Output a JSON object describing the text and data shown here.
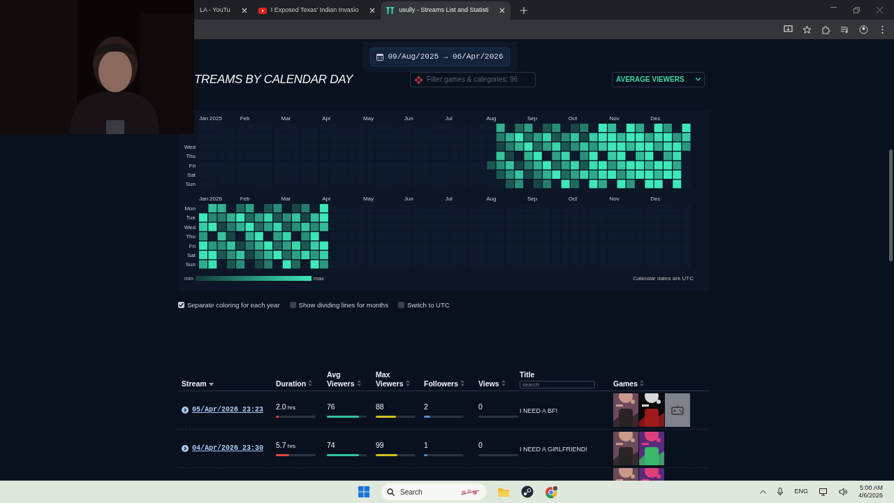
{
  "browser": {
    "tabs": [
      {
        "title": "LA - YouTu",
        "selected": false
      },
      {
        "title": "I Exposed Texas' Indian Invasio",
        "selected": false
      },
      {
        "title": "usully - Streams List and Statisti",
        "selected": true
      }
    ]
  },
  "webcam": {
    "kind": "picture"
  },
  "date_range": {
    "from": "09/Aug/2025",
    "arrow": "→",
    "to": "06/Apr/2026"
  },
  "heading": "TREAMS BY CALENDAR DAY",
  "filter": {
    "placeholder": "Filter games & categories: 96"
  },
  "metric_select": {
    "value": "AVERAGE VIEWERS"
  },
  "calendar": {
    "years": [
      {
        "months": [
          "Jan 2025",
          "Feb",
          "Mar",
          "Apr",
          "May",
          "Jun",
          "Jul",
          "Aug",
          "Sep",
          "Oct",
          "Nov",
          "Dec"
        ],
        "day_labels": [
          "Wed",
          "Thu",
          "Fri",
          "Sat",
          "Sun"
        ]
      },
      {
        "months": [
          "Jan 2026",
          "Feb",
          "Mar",
          "Apr",
          "May",
          "Jun",
          "Jul",
          "Aug",
          "Sep",
          "Oct",
          "Nov",
          "Dec"
        ],
        "day_labels": [
          "Mon",
          "Tue",
          "Wed",
          "Thu",
          "Fri",
          "Sat",
          "Sun"
        ]
      }
    ],
    "legend_min": "min",
    "legend_max": "max",
    "note": "Calendar dates are UTC"
  },
  "options": [
    {
      "label": "Separate coloring for each year",
      "checked": true
    },
    {
      "label": "Show dividing lines for months",
      "checked": false
    },
    {
      "label": "Switch to UTC",
      "checked": false
    }
  ],
  "table": {
    "columns": [
      {
        "label": "Stream",
        "sorted": true
      },
      {
        "label": "Duration",
        "sorted": false
      },
      {
        "label": "Avg Viewers",
        "sorted": false
      },
      {
        "label": "Max Viewers",
        "sorted": false
      },
      {
        "label": "Followers",
        "sorted": false
      },
      {
        "label": "Views",
        "sorted": false
      },
      {
        "label": "Title",
        "search_placeholder": "search"
      },
      {
        "label": "Games",
        "sorted": false
      }
    ],
    "rows": [
      {
        "stream": "05/Apr/2026 23:23",
        "duration": {
          "value": "2.0",
          "unit": "hrs",
          "level": 0.07
        },
        "avg": {
          "value": "76",
          "level": 0.8
        },
        "max": {
          "value": "88",
          "level": 0.5
        },
        "followers": {
          "value": "2",
          "level": 0.15
        },
        "views": {
          "value": "0"
        },
        "title": "I NEED A BF!",
        "games": [
          {
            "kind": "picture"
          },
          {
            "kind": "picture"
          },
          {
            "kind": "placeholder"
          }
        ]
      },
      {
        "stream": "04/Apr/2026 23:30",
        "duration": {
          "value": "5.7",
          "unit": "hrs",
          "level": 0.33
        },
        "avg": {
          "value": "74",
          "level": 0.8
        },
        "max": {
          "value": "99",
          "level": 0.55
        },
        "followers": {
          "value": "1",
          "level": 0.08
        },
        "views": {
          "value": "0"
        },
        "title": "I NEED A GIRLFRIEND!",
        "games": [
          {
            "kind": "picture"
          },
          {
            "kind": "picture"
          }
        ]
      },
      {
        "games": [
          {
            "kind": "picture"
          },
          {
            "kind": "picture"
          }
        ]
      }
    ]
  },
  "taskbar": {
    "search_placeholder": "Search",
    "language": "ENG",
    "time": "5:00 AM",
    "date": "4/6/2026"
  }
}
